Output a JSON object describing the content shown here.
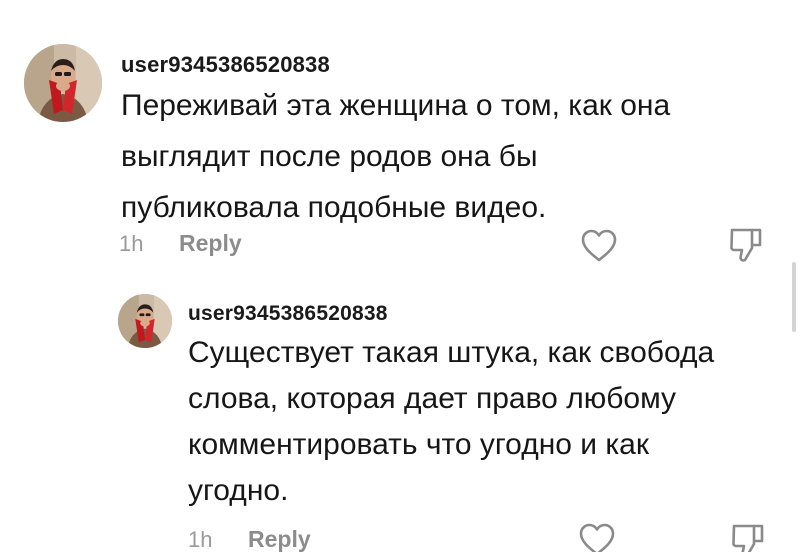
{
  "comments": [
    {
      "username": "user9345386520838",
      "text": "Переживай эта женщина о том, как она\nвыглядит после родов она бы\nпубликовала подобные видео.",
      "time": "1h",
      "reply_label": "Reply",
      "avatar_icon": "profile-photo",
      "like_icon": "heart-outline-icon",
      "dislike_icon": "thumbs-down-outline-icon"
    },
    {
      "username": "user9345386520838",
      "text": "Существует такая штука, как свобода\nслова, которая дает право любому\nкомментировать что угодно и как\nугодно.",
      "time": "1h",
      "reply_label": "Reply",
      "avatar_icon": "profile-photo",
      "like_icon": "heart-outline-icon",
      "dislike_icon": "thumbs-down-outline-icon"
    }
  ],
  "colors": {
    "text": "#161616",
    "meta": "#8c8c8c",
    "icon": "#8a8a8a",
    "avatar_accent": "#c0181c"
  }
}
